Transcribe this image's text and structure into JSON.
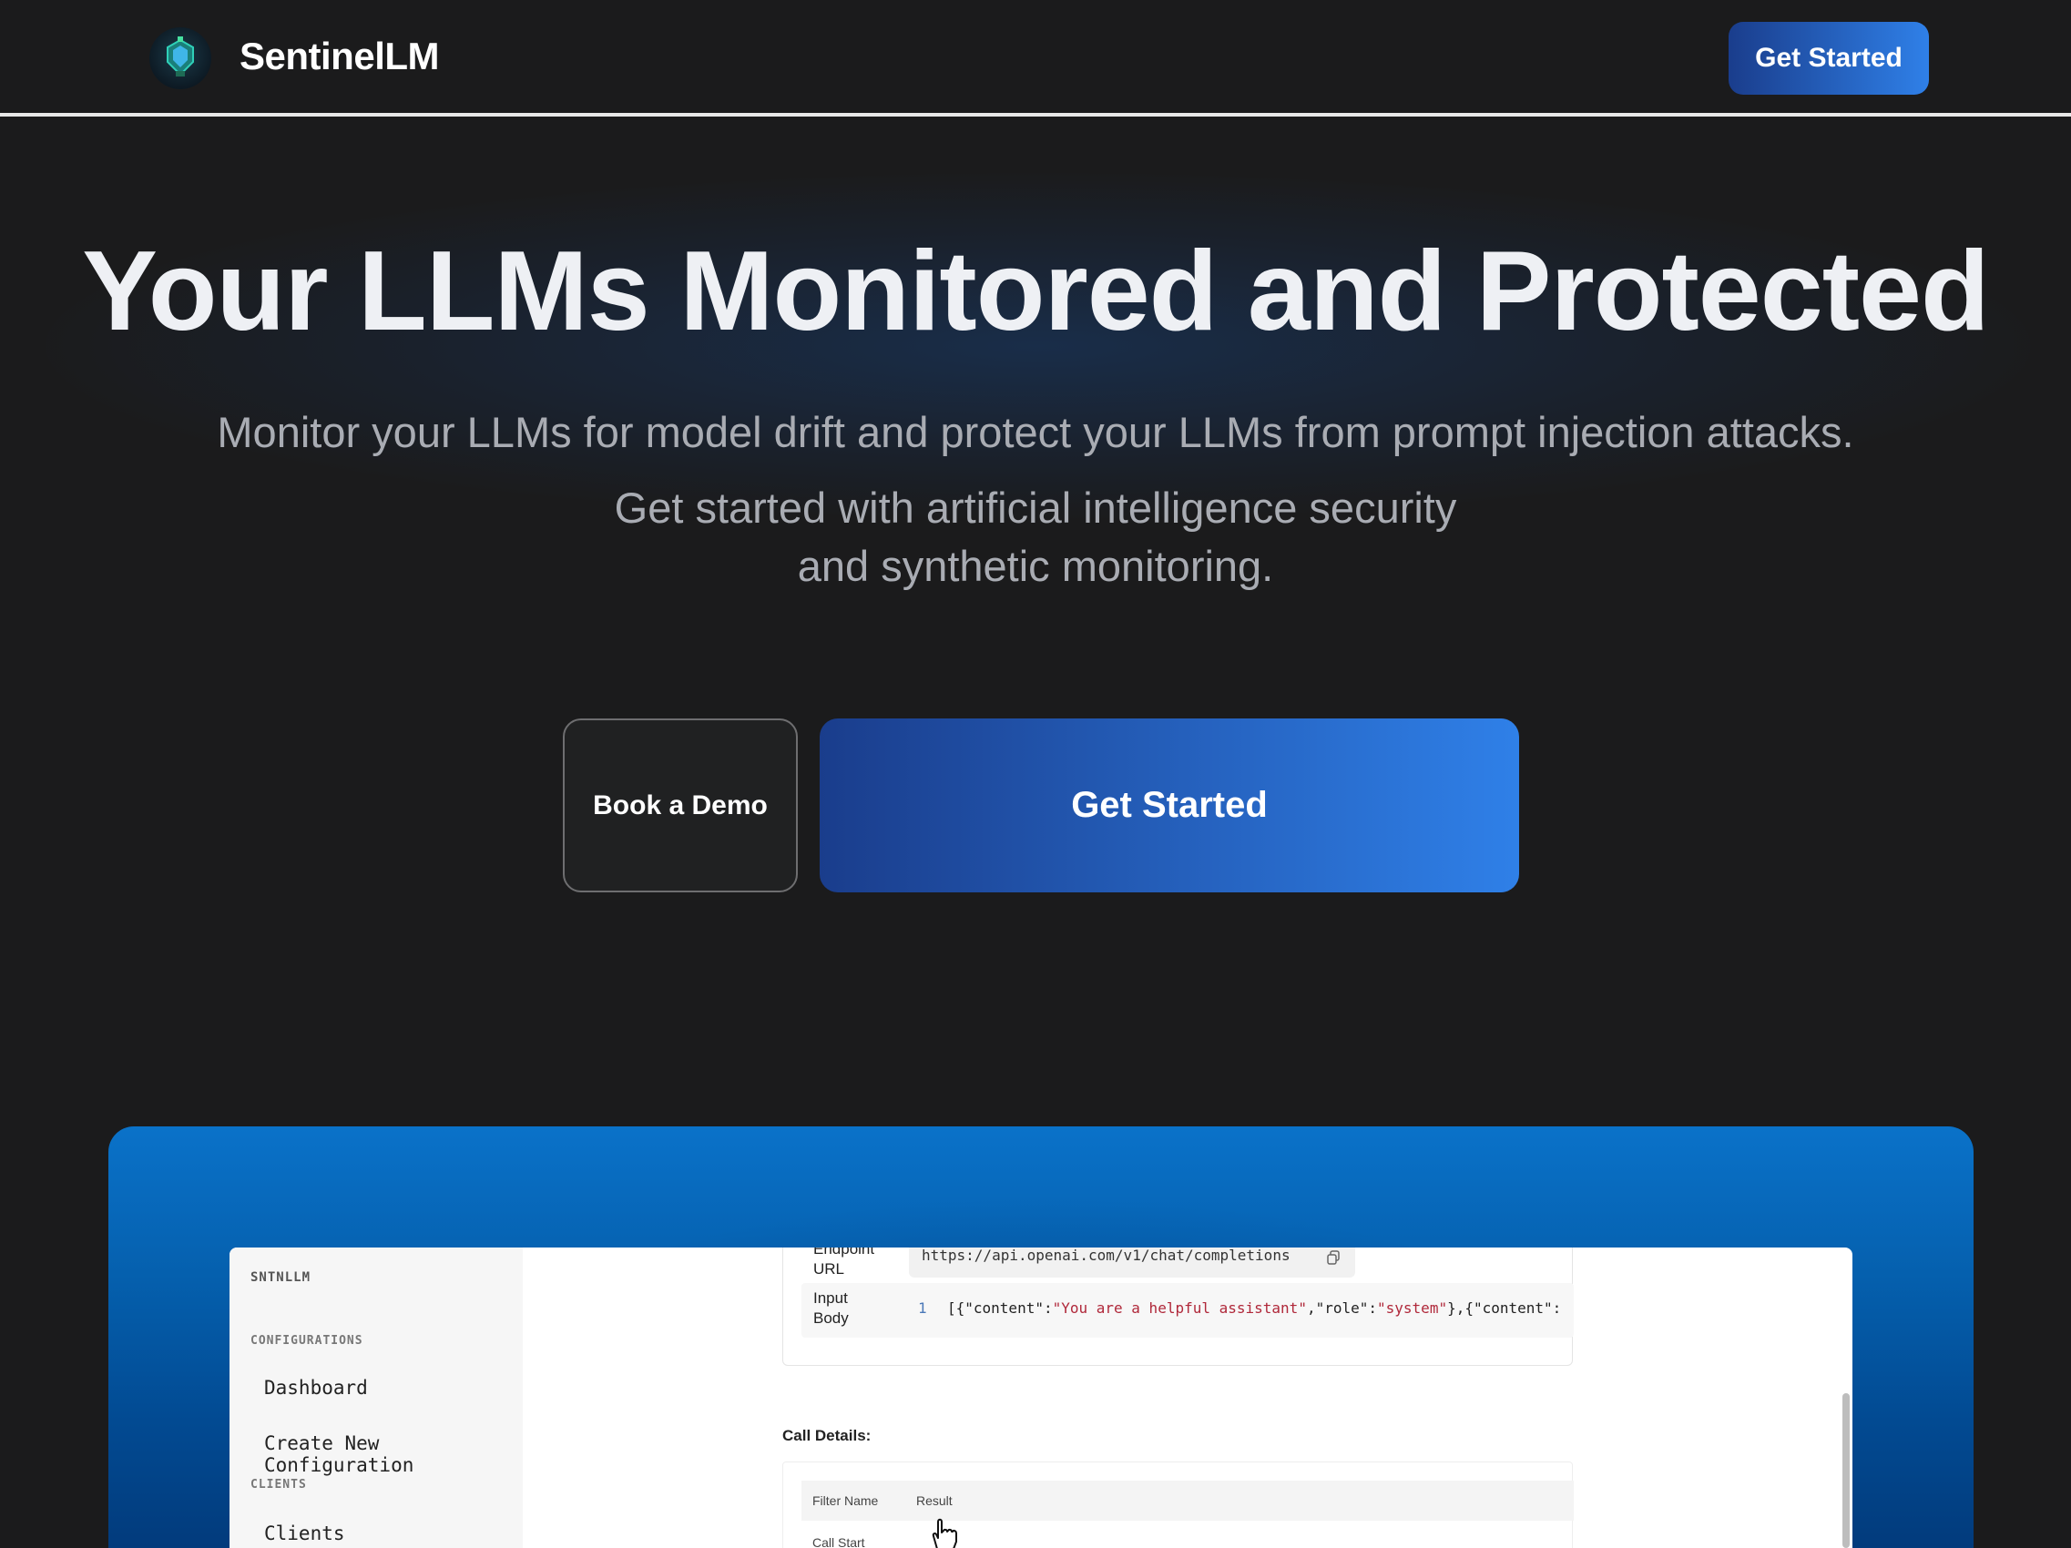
{
  "header": {
    "brand": "SentinelLM",
    "cta_label": "Get Started"
  },
  "hero": {
    "title": "Your LLMs Monitored and Protected",
    "subtitle_line1": "Monitor your LLMs for model drift and protect your LLMs from prompt injection attacks.",
    "subtitle_line2a": "Get started with artificial intelligence security",
    "subtitle_line2b": "and synthetic monitoring.",
    "demo_label": "Book a Demo",
    "start_label": "Get Started"
  },
  "app_preview": {
    "brand": "SNTNLLM",
    "sections": {
      "configurations": "CONFIGURATIONS",
      "clients": "CLIENTS"
    },
    "items": {
      "dashboard": "Dashboard",
      "create_config": "Create New Configuration",
      "clients": "Clients"
    },
    "endpoint": {
      "label_top": "Endpoint",
      "label_bottom": "URL",
      "url": "https://api.openai.com/v1/chat/completions"
    },
    "input_body": {
      "label_top": "Input",
      "label_bottom": "Body",
      "line_number": "1",
      "code_prefix": "[{\"content\":",
      "code_str1": "\"You are a helpful assistant\"",
      "code_mid": ",\"role\":",
      "code_str2": "\"system\"",
      "code_suffix": "},{\"content\":"
    },
    "call_details": {
      "title": "Call Details:",
      "col_filter": "Filter Name",
      "col_result": "Result",
      "first_row": "Call Start"
    }
  },
  "colors": {
    "background": "#1b1b1c",
    "accent_start": "#1a3d8c",
    "accent_end": "#2f80e8",
    "showcase_top": "#0a72c9"
  }
}
